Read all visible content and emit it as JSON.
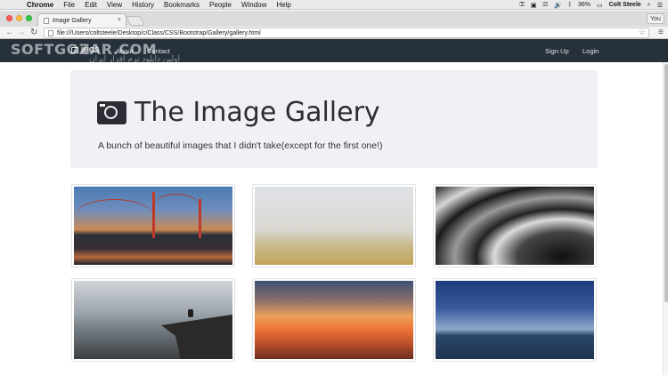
{
  "menubar": {
    "apple_symbol": "",
    "app_name": "Chrome",
    "items": [
      "File",
      "Edit",
      "View",
      "History",
      "Bookmarks",
      "People",
      "Window",
      "Help"
    ],
    "battery": "36%",
    "user": "Colt Steele"
  },
  "browser": {
    "tab_title": "Image Gallery",
    "tab_close": "×",
    "profile": "You",
    "url": "file:///Users/coltsteele/Desktop/c/Class/CSS/Bootstrap/Gallery/gallery.html"
  },
  "watermark": {
    "text": "SOFTGOZAR.COM",
    "subtext": "اولین دانلود نرم افزار ایران"
  },
  "navbar": {
    "brand": "IMGS",
    "links": [
      "About",
      "Contact"
    ],
    "right_links": [
      "Sign Up",
      "Login"
    ]
  },
  "jumbotron": {
    "title": "The Image Gallery",
    "subtitle": "A bunch of beautiful images that I didn't take(except for the first one!)"
  },
  "gallery": {
    "images": [
      {
        "subject": "golden-gate-bridge-at-dusk"
      },
      {
        "subject": "foggy-beach"
      },
      {
        "subject": "abstract-spiral-architecture"
      },
      {
        "subject": "person-on-cliff"
      },
      {
        "subject": "sunset-over-clouds"
      },
      {
        "subject": "ocean-horizon"
      }
    ]
  },
  "colors": {
    "navbar": "#27313c",
    "jumbotron": "#f1f0f5"
  }
}
